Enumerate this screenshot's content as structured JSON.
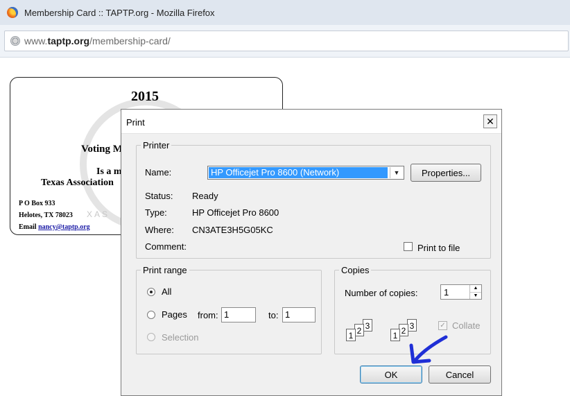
{
  "browser": {
    "title": "Membership Card :: TAPTP.org - Mozilla Firefox",
    "url_prefix": "www.",
    "url_domain": "taptp.org",
    "url_path": "/membership-card/"
  },
  "card": {
    "year": "2015",
    "voting": "Voting M",
    "member": "Is a mem",
    "association": "Texas Association",
    "address1": "P O Box 933",
    "address2": "Helotes, TX 78023",
    "email_label": "Email",
    "email": "nancy@taptp.org",
    "watermark_text": "XAS"
  },
  "dialog": {
    "title": "Print",
    "close_symbol": "✕",
    "printer": {
      "legend": "Printer",
      "name_label": "Name:",
      "name_value": "HP Officejet Pro 8600 (Network)",
      "properties_button": "Properties...",
      "status_label": "Status:",
      "status_value": "Ready",
      "type_label": "Type:",
      "type_value": "HP Officejet Pro 8600",
      "where_label": "Where:",
      "where_value": "CN3ATE3H5G05KC",
      "comment_label": "Comment:",
      "print_to_file_label": "Print to file"
    },
    "print_range": {
      "legend": "Print range",
      "all_label": "All",
      "pages_label": "Pages",
      "from_label": "from:",
      "from_value": "1",
      "to_label": "to:",
      "to_value": "1",
      "selection_label": "Selection",
      "selected": "All"
    },
    "copies": {
      "legend": "Copies",
      "number_label": "Number of copies:",
      "number_value": "1",
      "collate_label": "Collate",
      "collate_checked": true,
      "collate_check_symbol": "✓",
      "collate_icon_pages": [
        "1",
        "2",
        "3"
      ]
    },
    "ok_button": "OK",
    "cancel_button": "Cancel",
    "annotation_color": "#1f2fd6"
  }
}
